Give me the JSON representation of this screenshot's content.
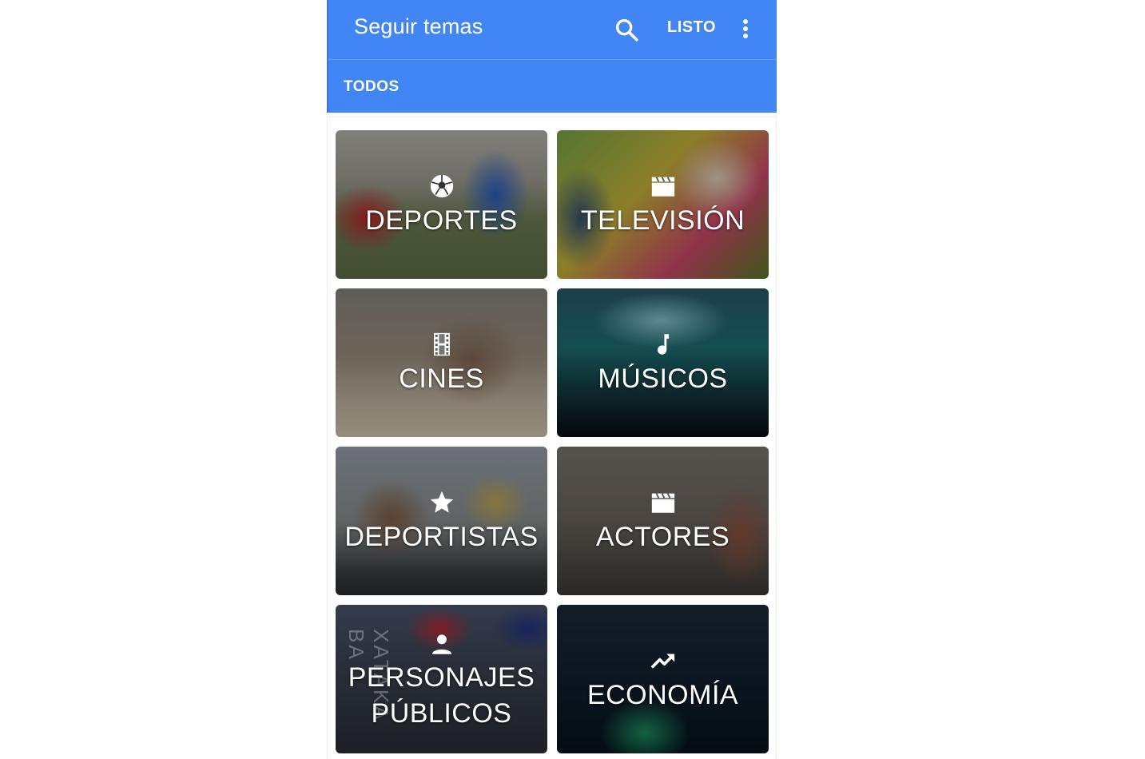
{
  "appbar": {
    "title": "Seguir temas",
    "search_icon": "search-icon",
    "done_label": "LISTO",
    "more_icon": "more-vert-icon"
  },
  "tabs": [
    {
      "label": "TODOS",
      "selected": true
    }
  ],
  "cards": [
    {
      "label": "DEPORTES",
      "icon": "soccer-ball-icon"
    },
    {
      "label": "TELEVISIÓN",
      "icon": "clapperboard-icon"
    },
    {
      "label": "CINES",
      "icon": "film-strip-icon"
    },
    {
      "label": "MÚSICOS",
      "icon": "music-note-icon"
    },
    {
      "label": "DEPORTISTAS",
      "icon": "star-icon"
    },
    {
      "label": "ACTORES",
      "icon": "clapperboard-icon"
    },
    {
      "label_line1": "PERSONAJES",
      "label_line2": "PÚBLICOS",
      "icon": "person-icon"
    },
    {
      "label": "ECONOMÍA",
      "icon": "trending-up-icon"
    }
  ],
  "watermark": "XATAKA BA",
  "colors": {
    "appbar": "#4285f4",
    "text_on_primary": "#ffffff",
    "background": "#ffffff"
  }
}
